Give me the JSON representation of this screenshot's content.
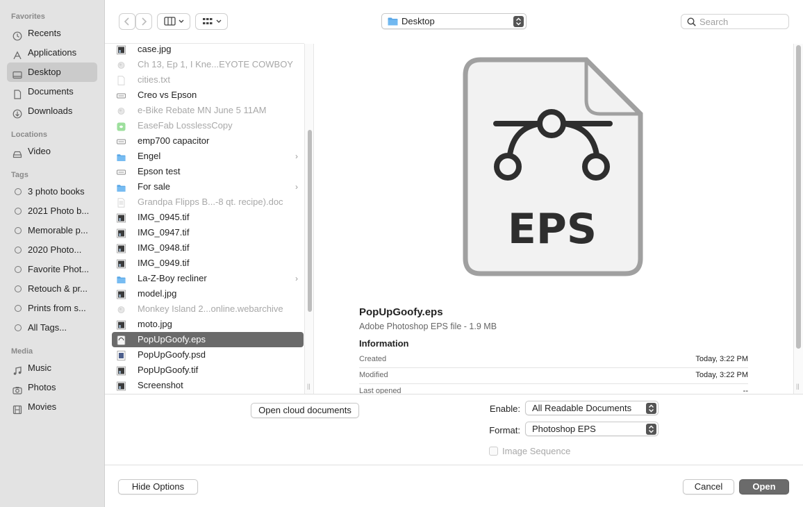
{
  "sidebar": {
    "favorites_heading": "Favorites",
    "favorites": [
      {
        "label": "Recents",
        "icon": "clock-icon"
      },
      {
        "label": "Applications",
        "icon": "applications-icon"
      },
      {
        "label": "Desktop",
        "icon": "desktop-icon",
        "selected": true
      },
      {
        "label": "Documents",
        "icon": "document-icon"
      },
      {
        "label": "Downloads",
        "icon": "download-icon"
      }
    ],
    "locations_heading": "Locations",
    "locations": [
      {
        "label": "Video",
        "icon": "drive-icon"
      }
    ],
    "tags_heading": "Tags",
    "tags": [
      {
        "label": "3 photo books"
      },
      {
        "label": "2021 Photo b..."
      },
      {
        "label": "Memorable p..."
      },
      {
        "label": "2020 Photo..."
      },
      {
        "label": "Favorite Phot..."
      },
      {
        "label": "Retouch & pr..."
      },
      {
        "label": "Prints from s..."
      },
      {
        "label": "All Tags..."
      }
    ],
    "media_heading": "Media",
    "media": [
      {
        "label": "Music",
        "icon": "music-icon"
      },
      {
        "label": "Photos",
        "icon": "camera-icon"
      },
      {
        "label": "Movies",
        "icon": "film-icon"
      }
    ]
  },
  "toolbar": {
    "location": "Desktop",
    "search_placeholder": "Search"
  },
  "files": [
    {
      "name": "case.jpg",
      "dim": false,
      "icon": "image-file-icon"
    },
    {
      "name": "Ch 13, Ep 1, I Kne...EYOTE COWBOY",
      "dim": true,
      "icon": "web-file-icon"
    },
    {
      "name": "cities.txt",
      "dim": true,
      "icon": "text-file-icon"
    },
    {
      "name": "Creo vs Epson",
      "dim": false,
      "icon": "file-icon"
    },
    {
      "name": "e-Bike Rebate MN June 5 11AM",
      "dim": true,
      "icon": "web-file-icon"
    },
    {
      "name": "EaseFab LosslessCopy",
      "dim": true,
      "icon": "app-icon"
    },
    {
      "name": "emp700 capacitor",
      "dim": false,
      "icon": "file-icon"
    },
    {
      "name": "Engel",
      "dim": false,
      "icon": "folder-icon",
      "folder": true
    },
    {
      "name": "Epson test",
      "dim": false,
      "icon": "file-icon"
    },
    {
      "name": "For sale",
      "dim": false,
      "icon": "folder-icon",
      "folder": true
    },
    {
      "name": "Grandpa Flipps B...-8 qt. recipe).doc",
      "dim": true,
      "icon": "doc-file-icon"
    },
    {
      "name": "IMG_0945.tif",
      "dim": false,
      "icon": "image-file-icon"
    },
    {
      "name": "IMG_0947.tif",
      "dim": false,
      "icon": "image-file-icon"
    },
    {
      "name": "IMG_0948.tif",
      "dim": false,
      "icon": "image-file-icon"
    },
    {
      "name": "IMG_0949.tif",
      "dim": false,
      "icon": "image-file-icon"
    },
    {
      "name": "La-Z-Boy recliner",
      "dim": false,
      "icon": "folder-icon",
      "folder": true
    },
    {
      "name": "model.jpg",
      "dim": false,
      "icon": "image-file-icon"
    },
    {
      "name": "Monkey Island 2...online.webarchive",
      "dim": true,
      "icon": "web-file-icon"
    },
    {
      "name": "moto.jpg",
      "dim": false,
      "icon": "image-file-icon"
    },
    {
      "name": "PopUpGoofy.eps",
      "dim": false,
      "icon": "eps-file-icon",
      "selected": true
    },
    {
      "name": "PopUpGoofy.psd",
      "dim": false,
      "icon": "psd-file-icon"
    },
    {
      "name": "PopUpGoofy.tif",
      "dim": false,
      "icon": "image-file-icon"
    },
    {
      "name": "Screenshot",
      "dim": false,
      "icon": "image-file-icon"
    }
  ],
  "preview": {
    "icon_text": "EPS",
    "filename": "PopUpGoofy.eps",
    "kind": "Adobe Photoshop EPS file - 1.9 MB",
    "info_heading": "Information",
    "info": [
      {
        "key": "Created",
        "value": "Today, 3:22 PM"
      },
      {
        "key": "Modified",
        "value": "Today, 3:22 PM"
      },
      {
        "key": "Last opened",
        "value": "--"
      }
    ]
  },
  "options": {
    "cloud_button": "Open cloud documents",
    "enable_label": "Enable:",
    "enable_value": "All Readable Documents",
    "format_label": "Format:",
    "format_value": "Photoshop EPS",
    "image_sequence_label": "Image Sequence"
  },
  "footer": {
    "hide_options": "Hide Options",
    "cancel": "Cancel",
    "open": "Open"
  }
}
